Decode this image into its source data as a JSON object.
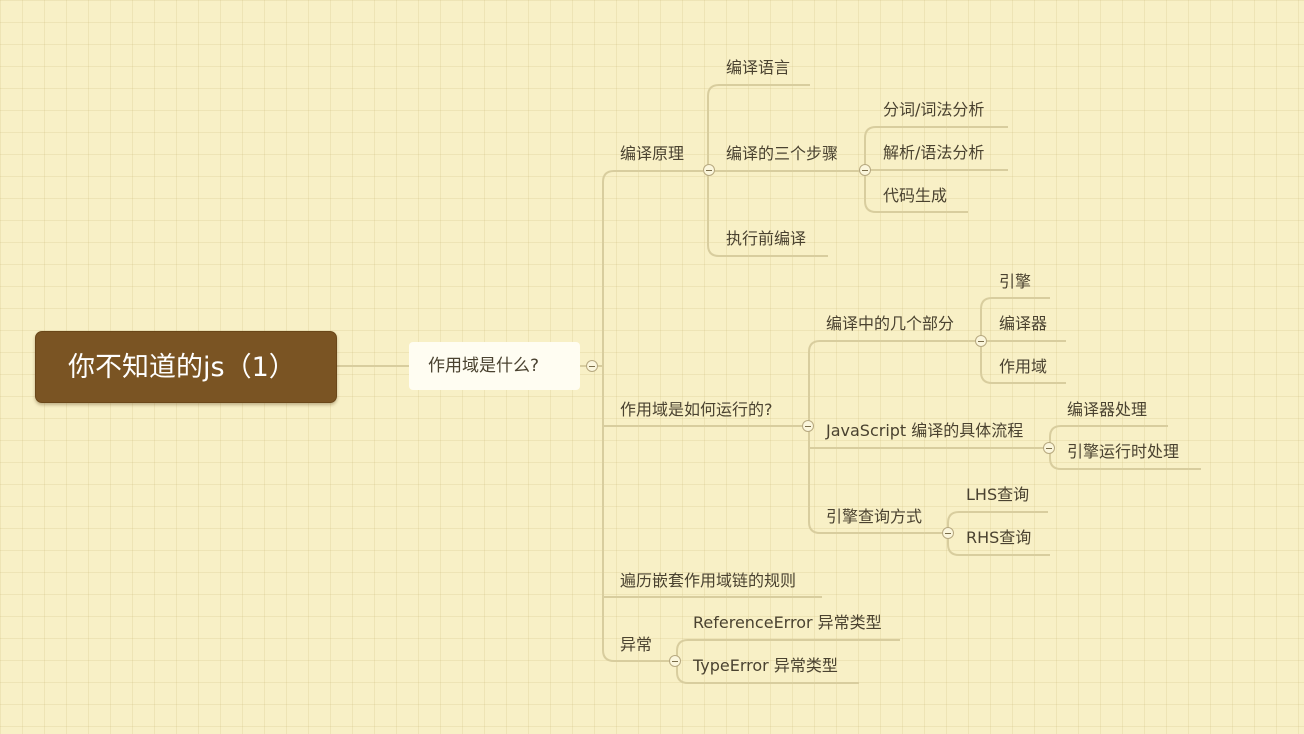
{
  "root": {
    "label": "你不知道的js（1）"
  },
  "level1": {
    "label": "作用域是什么?"
  },
  "branches": {
    "compile_principle": {
      "label": "编译原理",
      "compile_language": "编译语言",
      "three_steps": {
        "label": "编译的三个步骤",
        "items": [
          "分词/词法分析",
          "解析/语法分析",
          "代码生成"
        ]
      },
      "pre_execution": "执行前编译"
    },
    "how_scope_runs": {
      "label": "作用域是如何运行的?",
      "parts": {
        "label": "编译中的几个部分",
        "items": [
          "引擎",
          "编译器",
          "作用域"
        ]
      },
      "js_flow": {
        "label": "JavaScript 编译的具体流程",
        "items": [
          "编译器处理",
          "引擎运行时处理"
        ]
      },
      "lookup": {
        "label": "引擎查询方式",
        "items": [
          "LHS查询",
          "RHS查询"
        ]
      }
    },
    "nested_rules": {
      "label": "遍历嵌套作用域链的规则"
    },
    "exceptions": {
      "label": "异常",
      "items": [
        "ReferenceError 异常类型",
        "TypeError 异常类型"
      ]
    }
  },
  "colors": {
    "background": "#f8f0c6",
    "root_fill": "#7a5423",
    "connector": "#d8cd9e",
    "text": "#4a4230"
  }
}
